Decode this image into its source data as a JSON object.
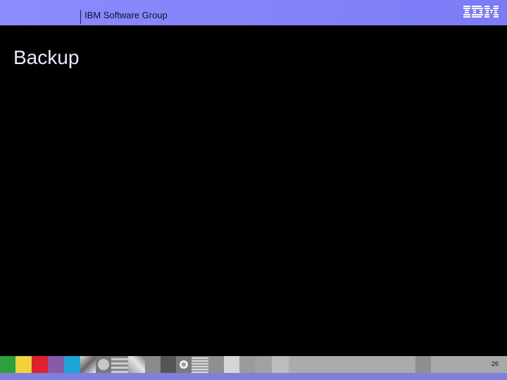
{
  "header": {
    "group_label": "IBM Software Group",
    "logo_text": "IBM"
  },
  "slide": {
    "title": "Backup"
  },
  "footer": {
    "page_number": "26"
  },
  "colors": {
    "header_bg": "#8c8cff",
    "slide_bg": "#000000",
    "title_text": "#e8e8ff",
    "footer_band": "#7f7fe0",
    "footer_strip": "#a9a9a9",
    "tile_green": "#2e9f3e",
    "tile_yellow": "#f0d23a",
    "tile_red": "#e0202a",
    "tile_purple": "#8a5aa8",
    "tile_cyan": "#1aa7d8"
  }
}
